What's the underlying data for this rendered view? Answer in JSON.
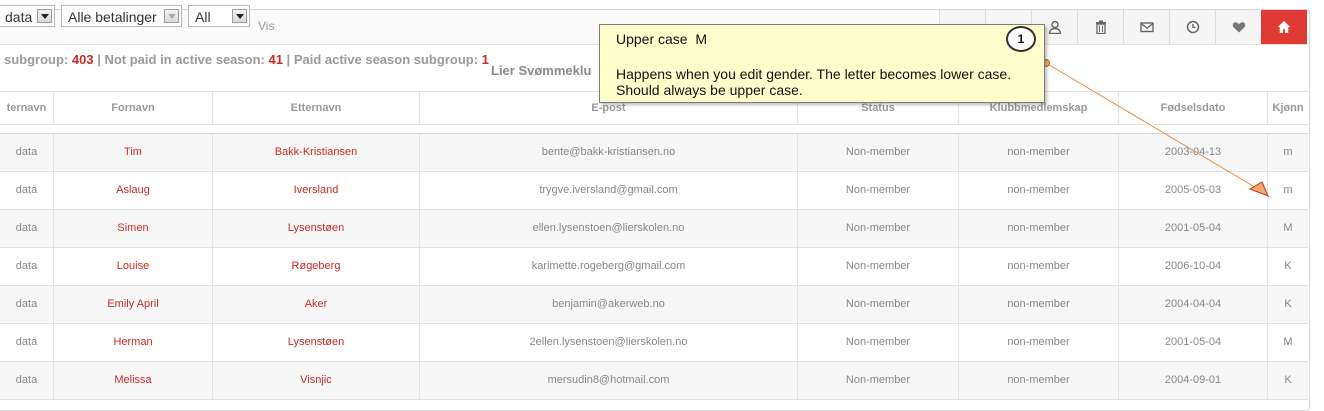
{
  "toolbar": {
    "select1": "data",
    "select2": "Alle betalinger",
    "select3": "All",
    "vis_label": "Vis",
    "icons": [
      "user-icon",
      "user-icon",
      "trash-icon",
      "envelope-icon",
      "clock-icon",
      "heart-icon",
      "home-icon"
    ]
  },
  "stats": {
    "label1": "subgroup:",
    "value1": "403",
    "sep1": " | ",
    "label2": "Not paid in active season:",
    "value2": "41",
    "sep2": " | ",
    "label3": "Paid active season subgroup:",
    "value3": "1",
    "club": "Lier Svømmeklu"
  },
  "table": {
    "headers": [
      "ternavn",
      "Fornavn",
      "Etternavn",
      "E-post",
      "Status",
      "Klubbmedlemskap",
      "Fødselsdato",
      "Kjønn"
    ],
    "rows": [
      {
        "c0": "data",
        "fornavn": "Tim",
        "etternavn": "Bakk-Kristiansen",
        "epost": "bente@bakk-kristiansen.no",
        "status": "Non-member",
        "klubb": "non-member",
        "fdato": "2003-04-13",
        "kjonn": "m"
      },
      {
        "c0": "data",
        "fornavn": "Aslaug",
        "etternavn": "Iversland",
        "epost": "trygve.iversland@gmail.com",
        "status": "Non-member",
        "klubb": "non-member",
        "fdato": "2005-05-03",
        "kjonn": "m"
      },
      {
        "c0": "data",
        "fornavn": "Simen",
        "etternavn": "Lysenstøen",
        "epost": "ellen.lysenstoen@lierskolen.no",
        "status": "Non-member",
        "klubb": "non-member",
        "fdato": "2001-05-04",
        "kjonn": "M"
      },
      {
        "c0": "data",
        "fornavn": "Louise",
        "etternavn": "Røgeberg",
        "epost": "karimette.rogeberg@gmail.com",
        "status": "Non-member",
        "klubb": "non-member",
        "fdato": "2006-10-04",
        "kjonn": "K"
      },
      {
        "c0": "data",
        "fornavn": "Emily April",
        "etternavn": "Aker",
        "epost": "benjamin@akerweb.no",
        "status": "Non-member",
        "klubb": "non-member",
        "fdato": "2004-04-04",
        "kjonn": "K"
      },
      {
        "c0": "data",
        "fornavn": "Herman",
        "etternavn": "Lysenstøen",
        "epost": "2ellen.lysenstoen@lierskolen.no",
        "status": "Non-member",
        "klubb": "non-member",
        "fdato": "2001-05-04",
        "kjonn": "M"
      },
      {
        "c0": "data",
        "fornavn": "Melissa",
        "etternavn": "Visnjic",
        "epost": "mersudin8@hotmail.com",
        "status": "Non-member",
        "klubb": "non-member",
        "fdato": "2004-09-01",
        "kjonn": "K"
      }
    ]
  },
  "callout": {
    "number": "1",
    "title": "Upper case  M",
    "line1": "Happens when you edit gender. The letter becomes lower case.",
    "line2": "Should always be upper case."
  },
  "colors": {
    "accent": "#cc2b24",
    "home_button": "#e03a34",
    "callout_bg": "#ffffcc",
    "arrow": "#f08a3c"
  }
}
